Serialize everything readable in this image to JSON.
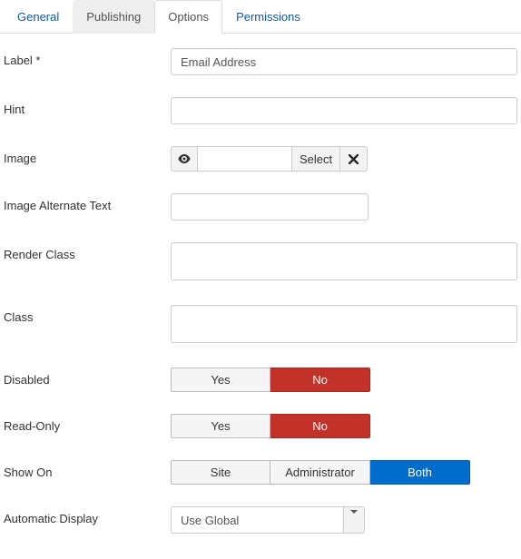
{
  "tabs": {
    "general": "General",
    "publishing": "Publishing",
    "options": "Options",
    "permissions": "Permissions"
  },
  "labels": {
    "label": "Label *",
    "hint": "Hint",
    "image": "Image",
    "image_alt": "Image Alternate Text",
    "render_class": "Render Class",
    "class": "Class",
    "disabled": "Disabled",
    "readonly": "Read-Only",
    "showon": "Show On",
    "auto_display": "Automatic Display"
  },
  "fields": {
    "label_value": "Email Address",
    "hint_value": "",
    "image_path": "",
    "image_select_btn": "Select",
    "image_alt_value": "",
    "render_class_value": "",
    "class_value": ""
  },
  "toggles": {
    "yes": "Yes",
    "no": "No",
    "disabled_selected": "No",
    "readonly_selected": "No"
  },
  "showon": {
    "site": "Site",
    "admin": "Administrator",
    "both": "Both",
    "selected": "Both"
  },
  "auto_display": {
    "selected": "Use Global"
  }
}
